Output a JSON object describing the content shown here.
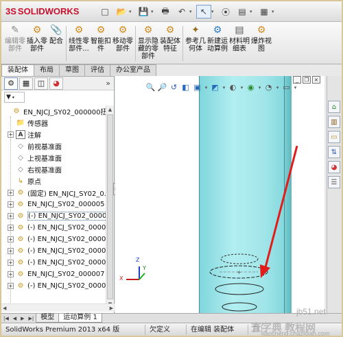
{
  "app": {
    "logo_mark": "3S",
    "logo_text": "SOLIDWORKS"
  },
  "quick_access": [
    {
      "icon": "new-doc-icon",
      "glyph": "□"
    },
    {
      "icon": "open-folder-icon",
      "glyph": "📂"
    },
    {
      "icon": "save-icon",
      "glyph": "💾"
    },
    {
      "icon": "print-icon",
      "glyph": "🖶"
    },
    {
      "icon": "undo-icon",
      "glyph": "↶"
    },
    {
      "icon": "select-pointer-icon",
      "glyph": "↖"
    },
    {
      "icon": "traffic-light-icon",
      "glyph": "⦿"
    },
    {
      "icon": "options-icon",
      "glyph": "▤"
    },
    {
      "icon": "settings-icon",
      "glyph": "▦"
    }
  ],
  "commands": [
    {
      "label": "编辑零\n部件",
      "icon": "edit-part-icon",
      "glyph": "✎",
      "disabled": true
    },
    {
      "label": "插入零\n部件",
      "icon": "insert-part-icon",
      "glyph": "⚙",
      "disabled": false
    },
    {
      "label": "配合",
      "icon": "mate-icon",
      "glyph": "📎",
      "disabled": false
    },
    {
      "label": "线性零\n部件...",
      "icon": "linear-pattern-icon",
      "glyph": "⚙",
      "disabled": false
    },
    {
      "label": "智能扣\n件",
      "icon": "smart-fastener-icon",
      "glyph": "⚙",
      "disabled": false
    },
    {
      "label": "移动零\n部件",
      "icon": "move-part-icon",
      "glyph": "⚙",
      "disabled": false
    },
    {
      "label": "显示隐\n藏的零\n部件",
      "icon": "show-hidden-icon",
      "glyph": "⚙",
      "disabled": false
    },
    {
      "label": "装配体\n特征",
      "icon": "assembly-feature-icon",
      "glyph": "⚙",
      "disabled": false
    },
    {
      "label": "参考几\n何体",
      "icon": "reference-geometry-icon",
      "glyph": "✦",
      "disabled": false
    },
    {
      "label": "新建运\n动算例",
      "icon": "new-motion-study-icon",
      "glyph": "⚙",
      "disabled": false
    },
    {
      "label": "材料明\n细表",
      "icon": "bom-icon",
      "glyph": "▤",
      "disabled": false
    },
    {
      "label": "爆炸视\n图",
      "icon": "exploded-view-icon",
      "glyph": "⚙",
      "disabled": false
    }
  ],
  "tabs": [
    "装配体",
    "布局",
    "草图",
    "评估",
    "办公室产品"
  ],
  "active_tab": 0,
  "feature_tree": [
    {
      "label": "EN_NJCJ_SY02_000000扭力...",
      "icon": "assembly-icon",
      "glyph": "⚙",
      "expander": "",
      "indent": 0
    },
    {
      "label": "传感器",
      "icon": "sensor-folder-icon",
      "glyph": "📁",
      "expander": "",
      "indent": 1
    },
    {
      "label": "注解",
      "icon": "annotation-icon",
      "glyph": "A",
      "expander": "+",
      "indent": 1
    },
    {
      "label": "前视基准面",
      "icon": "plane-icon",
      "glyph": "◇",
      "expander": "",
      "indent": 1
    },
    {
      "label": "上视基准面",
      "icon": "plane-icon",
      "glyph": "◇",
      "expander": "",
      "indent": 1
    },
    {
      "label": "右视基准面",
      "icon": "plane-icon",
      "glyph": "◇",
      "expander": "",
      "indent": 1
    },
    {
      "label": "原点",
      "icon": "origin-icon",
      "glyph": "↳",
      "expander": "",
      "indent": 1
    },
    {
      "label": "(固定) EN_NJCJ_SY02_0...",
      "icon": "part-icon",
      "glyph": "⚙",
      "expander": "+",
      "indent": 1
    },
    {
      "label": "EN_NJCJ_SY02_000005",
      "icon": "part-icon",
      "glyph": "⚙",
      "expander": "+",
      "indent": 1
    },
    {
      "label": "(-) EN_NJCJ_SY02_0000...",
      "icon": "part-icon",
      "glyph": "⚙",
      "expander": "+",
      "indent": 1,
      "selected": true
    },
    {
      "label": "(-) EN_NJCJ_SY02_0000...",
      "icon": "part-icon",
      "glyph": "⚙",
      "expander": "+",
      "indent": 1
    },
    {
      "label": "(-) EN_NJCJ_SY02_0000...",
      "icon": "part-icon",
      "glyph": "⚙",
      "expander": "+",
      "indent": 1
    },
    {
      "label": "(-) EN_NJCJ_SY02_0000...",
      "icon": "part-icon",
      "glyph": "⚙",
      "expander": "+",
      "indent": 1
    },
    {
      "label": "(-) EN_NJCJ_SY02_0000...",
      "icon": "part-icon",
      "glyph": "⚙",
      "expander": "+",
      "indent": 1
    },
    {
      "label": "EN_NJCJ_SY02_000007",
      "icon": "part-icon",
      "glyph": "⚙",
      "expander": "+",
      "indent": 1
    },
    {
      "label": "(-) EN_NJCJ_SY02_0000...",
      "icon": "part-icon",
      "glyph": "⚙",
      "expander": "+",
      "indent": 1
    }
  ],
  "view_tools": [
    "zoom-fit-icon",
    "zoom-area-icon",
    "previous-view-icon",
    "section-view-icon",
    "view-orientation-icon",
    "display-style-icon",
    "hide-show-icon",
    "appearance-icon",
    "scene-icon",
    "view-settings-icon"
  ],
  "triad": {
    "x": "X",
    "y": "Y",
    "z": "Z"
  },
  "bottom_tabs": [
    "模型",
    "运动算例 1"
  ],
  "active_bottom_tab": 1,
  "status": [
    "SolidWorks Premium 2013 x64 版",
    "欠定义",
    "在编辑 装配体",
    "自"
  ],
  "watermarks": {
    "site1": "jb51.net",
    "site2": "查字典 教程网",
    "site3": "jiaocheng.chazidian.com"
  }
}
